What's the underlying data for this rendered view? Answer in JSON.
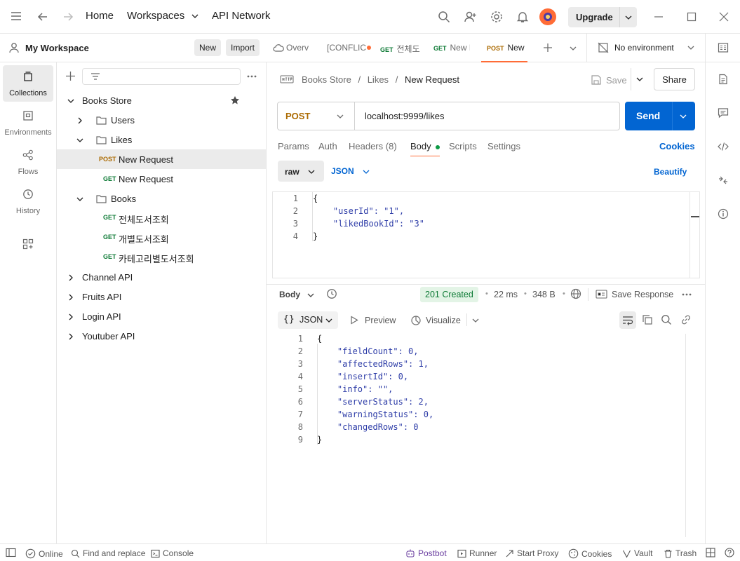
{
  "titlebar": {
    "home": "Home",
    "workspaces": "Workspaces",
    "api_network": "API Network",
    "upgrade": "Upgrade"
  },
  "workspace": {
    "name": "My Workspace",
    "new_label": "New",
    "import_label": "Import"
  },
  "leftnav": {
    "collections": "Collections",
    "environments": "Environments",
    "flows": "Flows",
    "history": "History"
  },
  "tree": {
    "root": "Books Store",
    "users": "Users",
    "likes": "Likes",
    "post_request": {
      "method": "POST",
      "name": "New Request"
    },
    "get_request": {
      "method": "GET",
      "name": "New Request"
    },
    "books": "Books",
    "books_items": [
      {
        "method": "GET",
        "name": "전체도서조회"
      },
      {
        "method": "GET",
        "name": "개별도서조회"
      },
      {
        "method": "GET",
        "name": "카테고리별도서조회"
      }
    ],
    "collections": [
      "Channel API",
      "Fruits API",
      "Login API",
      "Youtuber API"
    ]
  },
  "tabs": [
    {
      "method": "",
      "label": "Overv"
    },
    {
      "method": "",
      "label": "[CONFLIC"
    },
    {
      "method": "GET",
      "label": "전체도"
    },
    {
      "method": "GET",
      "label": "New F"
    },
    {
      "method": "POST",
      "label": "New"
    }
  ],
  "environment": "No environment",
  "breadcrumb": {
    "collection": "Books Store",
    "folder": "Likes",
    "request": "New Request",
    "sep": "/"
  },
  "actions": {
    "save": "Save",
    "share": "Share"
  },
  "request": {
    "method": "POST",
    "url": "localhost:9999/likes",
    "send": "Send"
  },
  "request_tabs": {
    "params": "Params",
    "auth": "Auth",
    "headers": "Headers",
    "headers_count": "(8)",
    "body": "Body",
    "scripts": "Scripts",
    "settings": "Settings",
    "cookies": "Cookies"
  },
  "body_options": {
    "raw": "raw",
    "json": "JSON",
    "beautify": "Beautify"
  },
  "request_body_lines": [
    "{",
    "    \"userId\": \"1\",",
    "    \"likedBookId\": \"3\"",
    "}"
  ],
  "response": {
    "body_label": "Body",
    "status": "201 Created",
    "time": "22 ms",
    "size": "348 B",
    "save_response": "Save Response",
    "format": "JSON",
    "preview": "Preview",
    "visualize": "Visualize",
    "lines": [
      "{",
      "    \"fieldCount\": 0,",
      "    \"affectedRows\": 1,",
      "    \"insertId\": 0,",
      "    \"info\": \"\",",
      "    \"serverStatus\": 2,",
      "    \"warningStatus\": 0,",
      "    \"changedRows\": 0",
      "}"
    ]
  },
  "statusbar": {
    "online": "Online",
    "find_replace": "Find and replace",
    "console": "Console",
    "postbot": "Postbot",
    "runner": "Runner",
    "start_proxy": "Start Proxy",
    "cookies": "Cookies",
    "vault": "Vault",
    "trash": "Trash"
  },
  "colors": {
    "accent": "#ff6c37",
    "send": "#0265d2",
    "get": "#0d7a35",
    "post": "#ab6a00",
    "status_ok": "#0d7a35"
  }
}
